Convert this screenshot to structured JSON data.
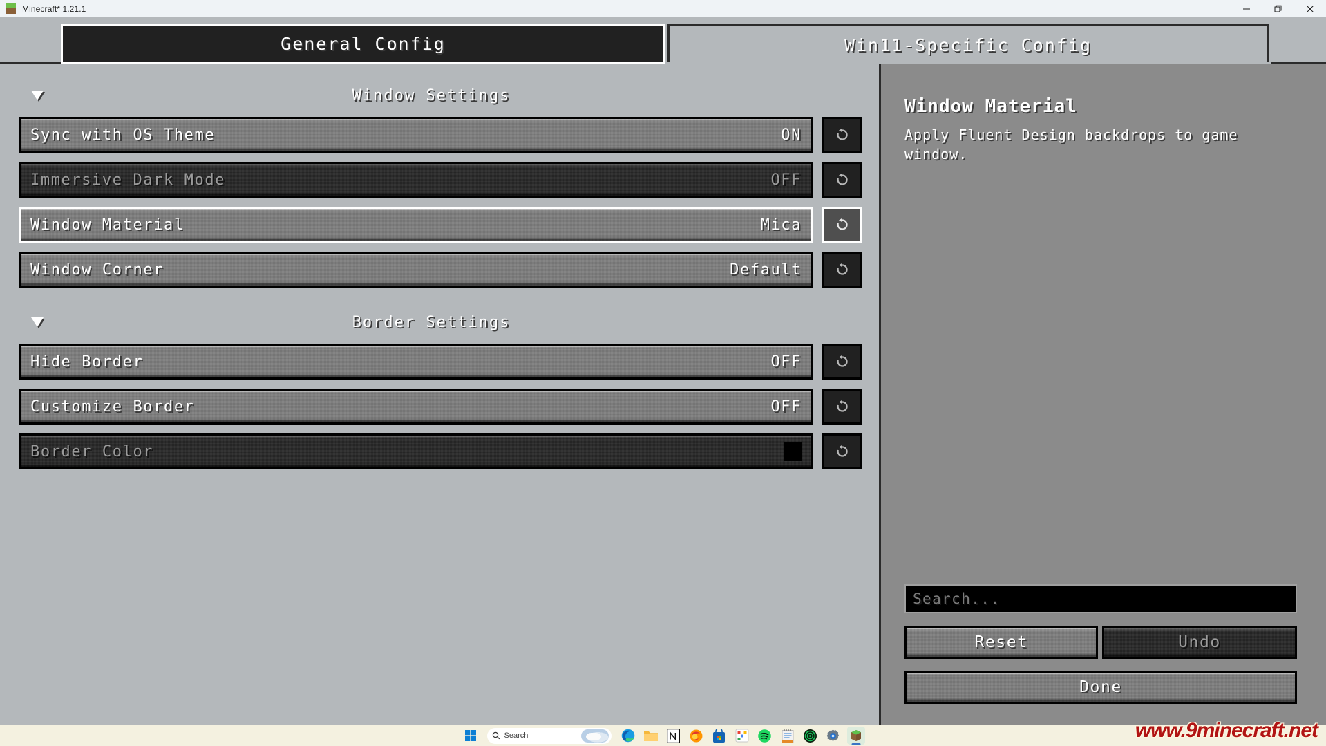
{
  "window": {
    "title": "Minecraft* 1.21.1",
    "icon": "grass-block-icon",
    "controls": {
      "minimize": "—",
      "restore": "❐",
      "close": "✕"
    }
  },
  "tabs": [
    {
      "label": "General Config",
      "selected": true
    },
    {
      "label": "Win11-Specific Config",
      "selected": false
    }
  ],
  "categories": [
    {
      "title": "Window Settings",
      "expanded": true,
      "rows": [
        {
          "label": "Sync with OS Theme",
          "value": "ON",
          "enabled": true,
          "focused": false,
          "type": "toggle"
        },
        {
          "label": "Immersive Dark Mode",
          "value": "OFF",
          "enabled": false,
          "focused": false,
          "type": "toggle"
        },
        {
          "label": "Window Material",
          "value": "Mica",
          "enabled": true,
          "focused": true,
          "type": "enum"
        },
        {
          "label": "Window Corner",
          "value": "Default",
          "enabled": true,
          "focused": false,
          "type": "enum"
        }
      ]
    },
    {
      "title": "Border Settings",
      "expanded": true,
      "rows": [
        {
          "label": "Hide Border",
          "value": "OFF",
          "enabled": true,
          "focused": false,
          "type": "toggle"
        },
        {
          "label": "Customize Border",
          "value": "OFF",
          "enabled": true,
          "focused": false,
          "type": "toggle"
        },
        {
          "label": "Border Color",
          "value": "",
          "enabled": false,
          "focused": false,
          "type": "color",
          "swatch": "#000000"
        }
      ]
    }
  ],
  "reset_icon": "undo-arrow-icon",
  "detail": {
    "title": "Window Material",
    "description": "Apply Fluent Design backdrops to game window."
  },
  "search": {
    "placeholder": "Search...",
    "value": ""
  },
  "buttons": {
    "reset": {
      "label": "Reset",
      "enabled": true
    },
    "undo": {
      "label": "Undo",
      "enabled": false
    },
    "done": {
      "label": "Done",
      "enabled": true
    }
  },
  "taskbar": {
    "search_placeholder": "Search",
    "icons": [
      "windows-start-icon",
      "edge-icon",
      "file-explorer-icon",
      "notion-icon",
      "firefox-icon",
      "microsoft-store-icon",
      "jamboard-icon",
      "spotify-icon",
      "notepad-icon",
      "ring-app-icon",
      "settings-icon",
      "minecraft-icon"
    ]
  },
  "watermark": "www.9minecraft.net"
}
